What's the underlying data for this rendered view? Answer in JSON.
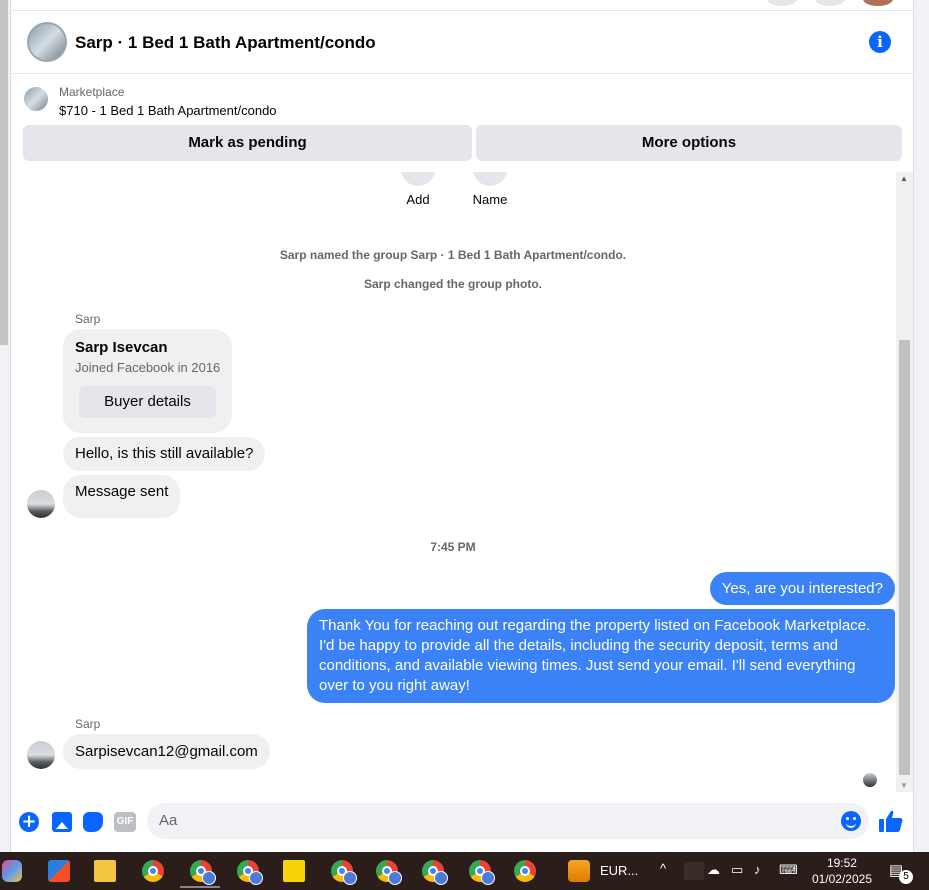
{
  "header": {
    "title": "Sarp · 1 Bed 1 Bath Apartment/condo"
  },
  "marketplace": {
    "label": "Marketplace",
    "listing": "$710 - 1 Bed 1 Bath Apartment/condo",
    "mark_pending": "Mark as pending",
    "more_options": "More options"
  },
  "actions": {
    "add": "Add",
    "name": "Name"
  },
  "thread": {
    "system_1": "Sarp named the group Sarp · 1 Bed 1 Bath Apartment/condo.",
    "system_2": "Sarp changed the group photo.",
    "sender_1": "Sarp",
    "card_name": "Sarp Isevcan",
    "card_sub": "Joined Facebook in 2016",
    "card_button": "Buyer details",
    "msg_in_1": "Hello, is this still available?",
    "msg_in_2": "Message sent",
    "timestamp": "7:45 PM",
    "msg_out_1": "Yes, are you interested?",
    "msg_out_2": "Thank You for reaching out regarding the property listed on Facebook Marketplace. I'd be happy to provide all the details, including the security deposit, terms and conditions, and available viewing times. Just send your email. I'll send everything over to you right away!",
    "sender_2": "Sarp",
    "msg_in_3": "Sarpisevcan12@gmail.com"
  },
  "composer": {
    "placeholder": "Aa",
    "gif": "GIF"
  },
  "taskbar": {
    "widget_text": "EUR...",
    "time": "19:52",
    "date": "01/02/2025",
    "notifications": "5"
  },
  "colors": {
    "accent": "#0866ff",
    "outgoing_bubble": "#3b82f6",
    "incoming_bubble": "#f0f0f0"
  }
}
